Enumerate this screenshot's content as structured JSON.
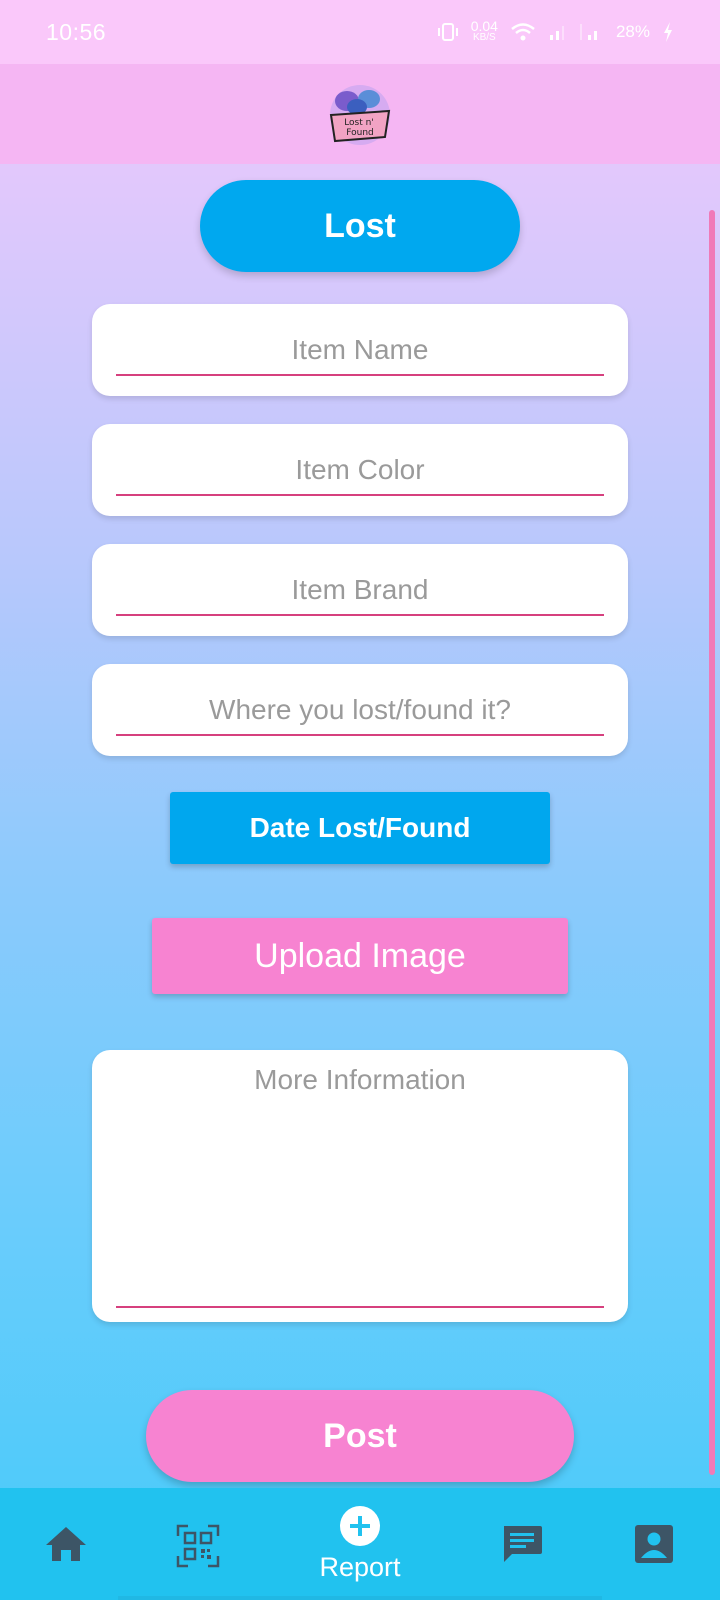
{
  "status_bar": {
    "time": "10:56",
    "net_speed_value": "0.04",
    "net_speed_unit": "KB/S",
    "battery": "28%"
  },
  "header": {
    "logo_text": "Lost n' Found"
  },
  "form": {
    "mode_label": "Lost",
    "item_name_placeholder": "Item Name",
    "item_color_placeholder": "Item Color",
    "item_brand_placeholder": "Item Brand",
    "location_placeholder": "Where you lost/found it?",
    "date_button_label": "Date Lost/Found",
    "upload_button_label": "Upload Image",
    "more_info_placeholder": "More Information",
    "post_button_label": "Post"
  },
  "bottom_nav": {
    "items": [
      {
        "id": "home",
        "icon": "home-icon"
      },
      {
        "id": "scan",
        "icon": "qr-code-icon"
      },
      {
        "id": "report",
        "icon": "add-circle-icon",
        "label": "Report"
      },
      {
        "id": "messages",
        "icon": "chat-icon"
      },
      {
        "id": "profile",
        "icon": "profile-icon"
      }
    ]
  },
  "colors": {
    "accent_blue": "#00a8ef",
    "accent_pink": "#f783d1",
    "underline": "#d6407e"
  }
}
